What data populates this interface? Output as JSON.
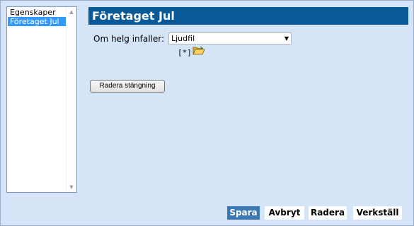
{
  "sidebar": {
    "items": [
      {
        "label": "Egenskaper",
        "selected": false
      },
      {
        "label": "Företaget Jul",
        "selected": true
      }
    ]
  },
  "main": {
    "title": "Företaget Jul",
    "holiday_label": "Om helg infaller:",
    "holiday_select_value": "Ljudfil",
    "tag_text": "[*]",
    "clear_button": "Radera stängning"
  },
  "footer": {
    "save": "Spara",
    "cancel": "Avbryt",
    "delete": "Radera",
    "apply": "Verkställ"
  },
  "colors": {
    "background": "#d6e4f7",
    "title_bar": "#0a5a9a",
    "selected_item": "#3399ff",
    "save_button": "#3d78b4"
  }
}
